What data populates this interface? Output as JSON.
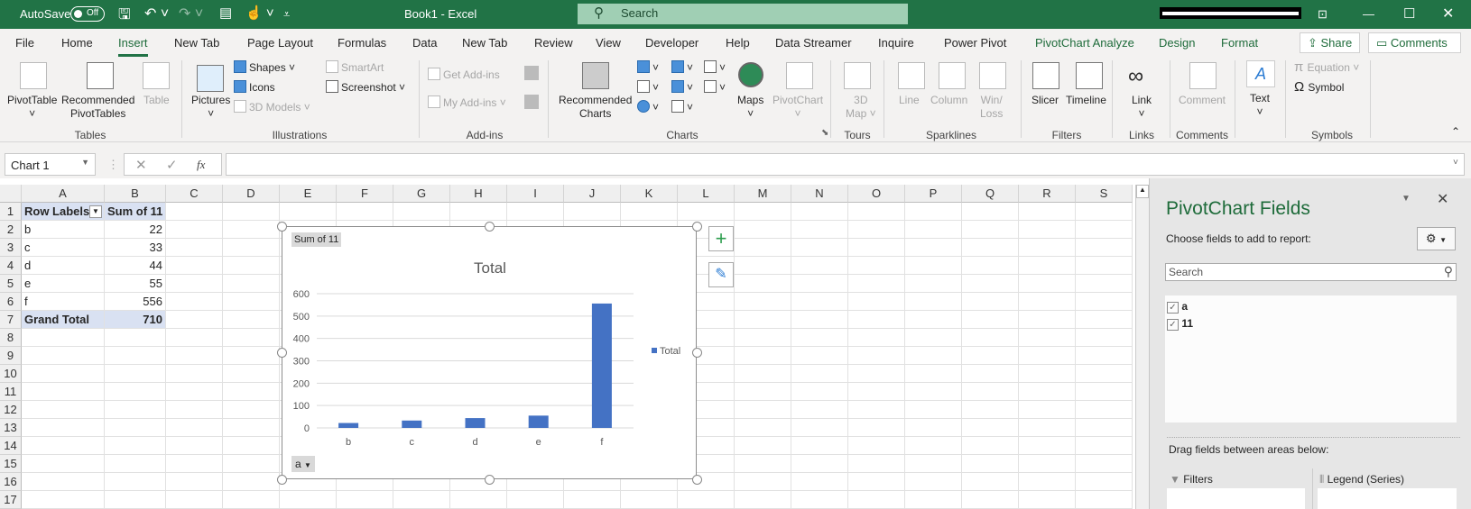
{
  "titlebar": {
    "autosave": "AutoSave",
    "autosave_state": "Off",
    "title": "Book1  -  Excel",
    "search": "Search"
  },
  "tabs": [
    "File",
    "Home",
    "Insert",
    "New Tab",
    "Page Layout",
    "Formulas",
    "Data",
    "New Tab",
    "Review",
    "View",
    "Developer",
    "Help",
    "Data Streamer",
    "Inquire",
    "Power Pivot",
    "PivotChart Analyze",
    "Design",
    "Format"
  ],
  "share": "Share",
  "comments_btn": "Comments",
  "ribbon": {
    "pivottable": "PivotTable",
    "recpivot1": "Recommended",
    "recpivot2": "PivotTables",
    "table": "Table",
    "g_tables": "Tables",
    "pictures": "Pictures",
    "shapes": "Shapes",
    "icons": "Icons",
    "models": "3D Models",
    "smartart": "SmartArt",
    "screenshot": "Screenshot",
    "g_illus": "Illustrations",
    "getaddins": "Get Add-ins",
    "myaddins": "My Add-ins",
    "g_addins": "Add-ins",
    "recch1": "Recommended",
    "recch2": "Charts",
    "maps": "Maps",
    "pivotchart": "PivotChart",
    "g_charts": "Charts",
    "map3d1": "3D",
    "map3d2": "Map",
    "g_tours": "Tours",
    "line": "Line",
    "column": "Column",
    "winloss1": "Win/",
    "winloss2": "Loss",
    "g_spark": "Sparklines",
    "slicer": "Slicer",
    "timeline": "Timeline",
    "g_filters": "Filters",
    "link": "Link",
    "g_links": "Links",
    "comment": "Comment",
    "g_comments": "Comments",
    "text": "Text",
    "equation": "Equation",
    "symbol": "Symbol",
    "g_symbols": "Symbols"
  },
  "formula_bar": {
    "name_box": "Chart 1",
    "fx": "fx",
    "value": ""
  },
  "sheet": {
    "columns": [
      "A",
      "B",
      "C",
      "D",
      "E",
      "F",
      "G",
      "H",
      "I",
      "J",
      "K",
      "L",
      "M",
      "N",
      "O",
      "P",
      "Q",
      "R",
      "S"
    ],
    "rows": [
      "1",
      "2",
      "3",
      "4",
      "5",
      "6",
      "7",
      "8",
      "9",
      "10",
      "11",
      "12",
      "13",
      "14",
      "15",
      "16",
      "17"
    ],
    "pivot": {
      "header": [
        "Row Labels",
        "Sum of 11"
      ],
      "rows": [
        [
          "b",
          "22"
        ],
        [
          "c",
          "33"
        ],
        [
          "d",
          "44"
        ],
        [
          "e",
          "55"
        ],
        [
          "f",
          "556"
        ]
      ],
      "total": [
        "Grand Total",
        "710"
      ]
    }
  },
  "chart_data": {
    "type": "bar",
    "title": "Total",
    "categories": [
      "b",
      "c",
      "d",
      "e",
      "f"
    ],
    "series": [
      {
        "name": "Total",
        "values": [
          22,
          33,
          44,
          55,
          556
        ],
        "color": "#4472c4"
      }
    ],
    "ylim": [
      0,
      600
    ],
    "yticks": [
      "0",
      "100",
      "200",
      "300",
      "400",
      "500",
      "600"
    ],
    "legend": "right",
    "grid": true,
    "value_button": "Sum of 11",
    "axis_button": "a"
  },
  "pane": {
    "title": "PivotChart Fields",
    "choose": "Choose fields to add to report:",
    "search_placeholder": "Search",
    "fields": [
      {
        "name": "a",
        "checked": true
      },
      {
        "name": "11",
        "checked": true
      }
    ],
    "drag": "Drag fields between areas below:",
    "filters": "Filters",
    "legend": "Legend (Series)"
  }
}
